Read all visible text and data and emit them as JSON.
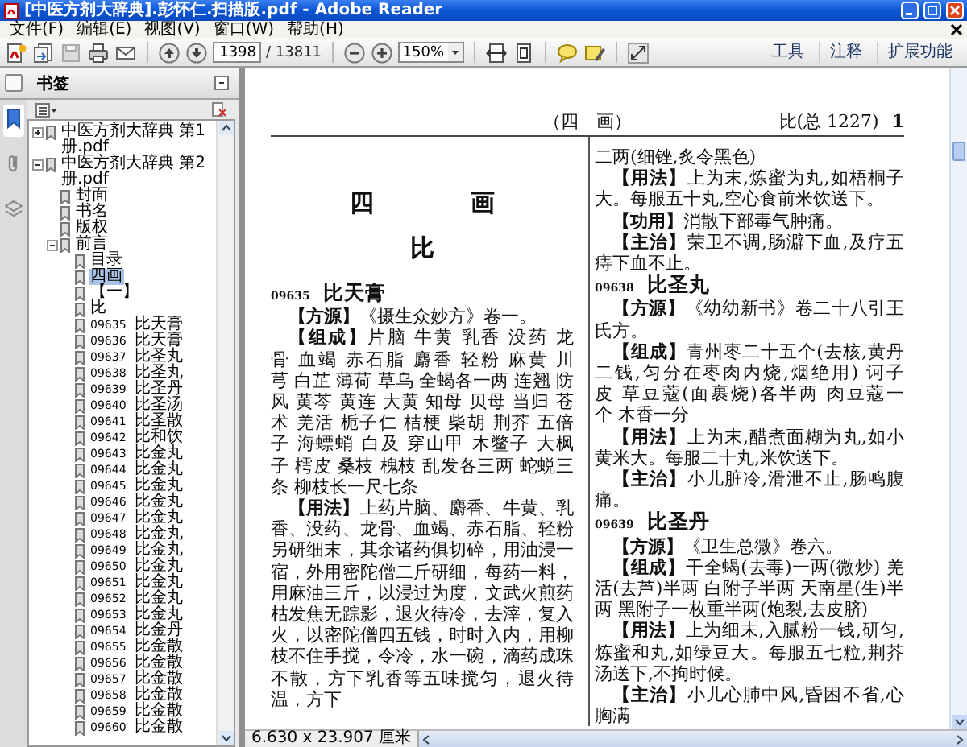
{
  "window": {
    "title": "[中医方剂大辞典].彭怀仁.扫描版.pdf - Adobe Reader"
  },
  "menu": [
    "文件(F)",
    "编辑(E)",
    "视图(V)",
    "窗口(W)",
    "帮助(H)"
  ],
  "toolbar": {
    "page_field": "1398",
    "page_total": "/ 13811",
    "zoom_field": "150%",
    "panels": [
      "工具",
      "注释",
      "扩展功能"
    ]
  },
  "sidebar": {
    "title": "书签",
    "nav": [
      {
        "kind": "bookmarks",
        "selected": true
      },
      {
        "kind": "attachments",
        "selected": false
      },
      {
        "kind": "layers",
        "selected": false
      }
    ],
    "tree": [
      {
        "label": "中医方剂大辞典 第1册.pdf",
        "expanded": false,
        "selected": false
      },
      {
        "label": "中医方剂大辞典 第2册.pdf",
        "expanded": true,
        "selected": false,
        "children": [
          {
            "label": "封面",
            "selected": false
          },
          {
            "label": "书名",
            "selected": false
          },
          {
            "label": "版权",
            "selected": false
          },
          {
            "label": "前言",
            "expanded": true,
            "selected": false,
            "children": [
              {
                "label": "目录",
                "selected": false
              },
              {
                "label": "四画",
                "selected": true
              },
              {
                "label": "【一】",
                "selected": false
              },
              {
                "label": "比",
                "selected": false
              },
              {
                "number": "09635",
                "label": "比天膏",
                "selected": false
              },
              {
                "number": "09636",
                "label": "比天膏",
                "selected": false
              },
              {
                "number": "09637",
                "label": "比圣丸",
                "selected": false
              },
              {
                "number": "09638",
                "label": "比圣丸",
                "selected": false
              },
              {
                "number": "09639",
                "label": "比圣丹",
                "selected": false
              },
              {
                "number": "09640",
                "label": "比圣汤",
                "selected": false
              },
              {
                "number": "09641",
                "label": "比圣散",
                "selected": false
              },
              {
                "number": "09642",
                "label": "比和饮",
                "selected": false
              },
              {
                "number": "09643",
                "label": "比金丸",
                "selected": false
              },
              {
                "number": "09644",
                "label": "比金丸",
                "selected": false
              },
              {
                "number": "09645",
                "label": "比金丸",
                "selected": false
              },
              {
                "number": "09646",
                "label": "比金丸",
                "selected": false
              },
              {
                "number": "09647",
                "label": "比金丸",
                "selected": false
              },
              {
                "number": "09648",
                "label": "比金丸",
                "selected": false
              },
              {
                "number": "09649",
                "label": "比金丸",
                "selected": false
              },
              {
                "number": "09650",
                "label": "比金丸",
                "selected": false
              },
              {
                "number": "09651",
                "label": "比金丸",
                "selected": false
              },
              {
                "number": "09652",
                "label": "比金丸",
                "selected": false
              },
              {
                "number": "09653",
                "label": "比金丸",
                "selected": false
              },
              {
                "number": "09654",
                "label": "比金丹",
                "selected": false
              },
              {
                "number": "09655",
                "label": "比金散",
                "selected": false
              },
              {
                "number": "09656",
                "label": "比金散",
                "selected": false
              },
              {
                "number": "09657",
                "label": "比金散",
                "selected": false
              },
              {
                "number": "09658",
                "label": "比金散",
                "selected": false
              },
              {
                "number": "09659",
                "label": "比金散",
                "selected": false
              },
              {
                "number": "09660",
                "label": "比金散",
                "selected": false
              }
            ]
          }
        ]
      }
    ]
  },
  "page": {
    "header_center": "（四　画）",
    "header_right": "比(总 1227)",
    "page_number": "1",
    "columns": [
      {
        "blocks": [
          {
            "kind": "section_heading",
            "text": "四　画"
          },
          {
            "kind": "letter_heading",
            "text": "比"
          },
          {
            "kind": "entry",
            "number": "09635",
            "name": "比天膏"
          },
          {
            "kind": "field",
            "text": "**【方源】**《摄生众妙方》卷一。"
          },
          {
            "kind": "field",
            "text": "**【组成】**片脑 牛黄 乳香 没药 龙骨 血竭 赤石脂 麝香 轻粉 麻黄 川芎 白芷 薄荷 草乌 全蝎各一两 连翘 防风 黄芩 黄连 大黄 知母 贝母 当归 苍术 羌活 栀子仁 桔梗 柴胡 荆芥 五倍子 海螵蛸 白及 穿山甲 木鳖子 大枫子 樗皮 桑枝 槐枝 乱发各三两 蛇蜕三条 柳枝长一尺七条"
          },
          {
            "kind": "field",
            "text": "**【用法】**上药片脑、麝香、牛黄、乳香、没药、龙骨、血竭、赤石脂、轻粉另研细末，其余诸药俱切碎，用油浸一宿，外用密陀僧二斤研细，每药一料，用麻油三斤，以浸过为度，文武火煎药枯发焦无踪影，退火待冷，去滓，复入火，以密陀僧四五钱，时时入内，用柳枝不住手搅，令冷，水一碗，滴药成珠不散，方下乳香等五味搅匀，退火待温，方下"
          }
        ]
      },
      {
        "blocks": [
          {
            "kind": "continuation",
            "text": "二两(细锉,炙令黑色)"
          },
          {
            "kind": "field",
            "text": "**【用法】**上为末,炼蜜为丸,如梧桐子大。每服五十丸,空心食前米饮送下。"
          },
          {
            "kind": "field",
            "text": "**【功用】**消散下部毒气肿痛。"
          },
          {
            "kind": "field",
            "text": "**【主治】**荣卫不调,肠澼下血,及疗五痔下血不止。"
          },
          {
            "kind": "entry",
            "number": "09638",
            "name": "比圣丸"
          },
          {
            "kind": "field",
            "text": "**【方源】**《幼幼新书》卷二十八引王氏方。"
          },
          {
            "kind": "field",
            "text": "**【组成】**青州枣二十五个(去核,黄丹二钱,匀分在枣肉内烧,烟绝用) 诃子皮 草豆蔻(面裹烧)各半两 肉豆蔻一个 木香一分"
          },
          {
            "kind": "field",
            "text": "**【用法】**上为末,醋煮面糊为丸,如小黄米大。每服二十丸,米饮送下。"
          },
          {
            "kind": "field",
            "text": "**【主治】**小儿脏冷,滑泄不止,肠鸣腹痛。"
          },
          {
            "kind": "entry",
            "number": "09639",
            "name": "比圣丹"
          },
          {
            "kind": "field",
            "text": "**【方源】**《卫生总微》卷六。"
          },
          {
            "kind": "field",
            "text": "**【组成】**干全蝎(去毒)一两(微炒) 羌活(去芦)半两 白附子半两 天南星(生)半两 黑附子一枚重半两(炮裂,去皮脐)"
          },
          {
            "kind": "field",
            "text": "**【用法】**上为细末,入腻粉一钱,研匀,炼蜜和丸,如绿豆大。每服五七粒,荆芥汤送下,不拘时候。"
          },
          {
            "kind": "field",
            "text": "**【主治】**小儿心肺中风,昏困不省,心胸满"
          }
        ]
      }
    ]
  },
  "status_bar": {
    "page_size": "6.630 x 23.907 厘米"
  }
}
